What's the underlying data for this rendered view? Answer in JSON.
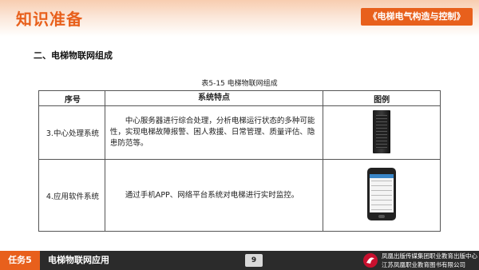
{
  "header": {
    "title": "知识准备",
    "book_title": "《电梯电气构造与控制》"
  },
  "section": {
    "title": "二、电梯物联网组成"
  },
  "table": {
    "caption": "表5-15   电梯物联网组成",
    "headers": [
      "序号",
      "系统特点",
      "图例"
    ],
    "rows": [
      {
        "index": "3.中心处理系统",
        "feature": "中心服务器进行综合处理，分析电梯运行状态的多种可能性，实现电梯故障报警、困人救援、日常管理、质量评估、隐患防范等。",
        "image": "server-rack-icon"
      },
      {
        "index": "4.应用软件系统",
        "feature": "通过手机APP、网络平台系统对电梯进行实时监控。",
        "image": "smartphone-icon"
      }
    ]
  },
  "footer": {
    "task_label": "任务5",
    "task_title": "电梯物联网应用",
    "page_number": "9",
    "publisher_line1": "凤凰出版传媒集团职业教育出版中心",
    "publisher_line2": "江苏凤凰职业教育图书有限公司"
  },
  "colors": {
    "accent": "#e8601c",
    "footer_bg": "#2b2b2b"
  }
}
